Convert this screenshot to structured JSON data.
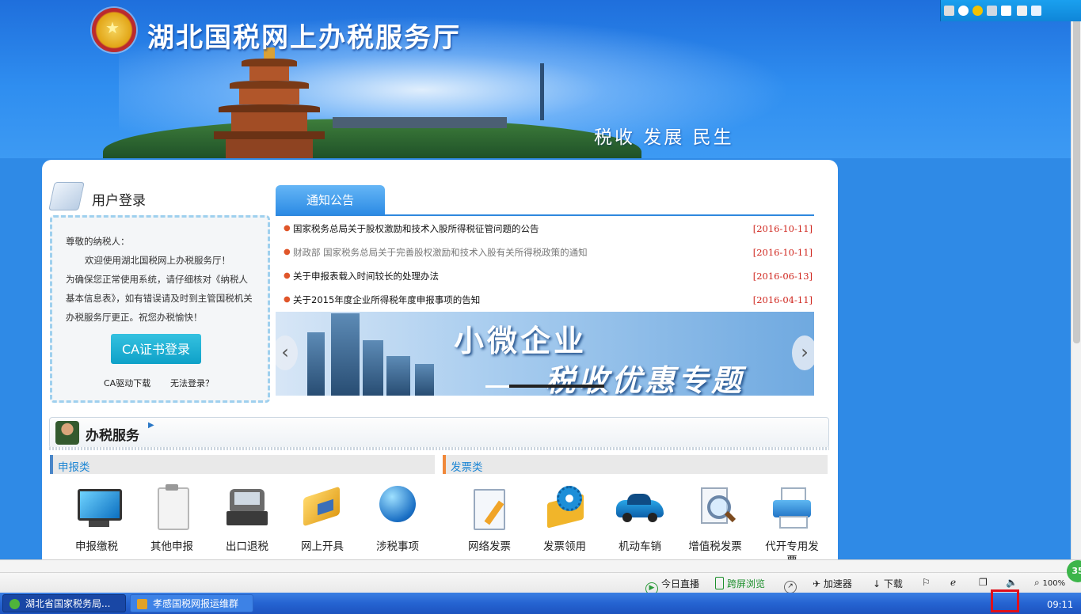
{
  "header": {
    "site_title": "湖北国税网上办税服务厅",
    "slogan": "税收  发展  民生"
  },
  "login": {
    "title": "用户登录",
    "greeting": "尊敬的纳税人：",
    "welcome": "欢迎使用湖北国税网上办税服务厅！",
    "notice_text": "为确保您正常使用系统，请仔细核对《纳税人基本信息表》，如有错误请及时到主管国税机关办税服务厅更正。祝您办税愉快！",
    "ca_button": "CA证书登录",
    "ca_driver_link": "CA驱动下载",
    "cannot_login_link": "无法登录？"
  },
  "notice": {
    "tab_label": "通知公告",
    "items": [
      {
        "text": "国家税务总局关于股权激励和技术入股所得税征管问题的公告",
        "date": "[2016-10-11]"
      },
      {
        "text": "财政部  国家税务总局关于完善股权激励和技术入股有关所得税政策的通知",
        "date": "[2016-10-11]"
      },
      {
        "text": "关于申报表载入时间较长的处理办法",
        "date": "[2016-06-13]"
      },
      {
        "text": "关于2015年度企业所得税年度申报事项的告知",
        "date": "[2016-04-11]"
      }
    ]
  },
  "banner": {
    "line1": "小微企业",
    "line2": "税收优惠专题",
    "prev": "‹",
    "next": "›"
  },
  "services": {
    "title": "办税服务",
    "category_declare": "申报类",
    "category_invoice": "发票类",
    "declare_items": [
      "申报缴税",
      "其他申报",
      "出口退税",
      "网上开具",
      "涉税事项"
    ],
    "invoice_items": [
      "网络发票",
      "发票领用",
      "机动车销",
      "增值税发票",
      "代开专用发票"
    ]
  },
  "browser_toolbar": {
    "live": "今日直播",
    "cross_screen": "跨屏浏览",
    "accelerator": "加速器",
    "download": "下载",
    "zoom": "100%",
    "badge": "35"
  },
  "taskbar": {
    "task1": "湖北省国家税务局...",
    "task2": "孝感国税网报运维群",
    "clock": "09:11"
  },
  "colors": {
    "accent": "#2f88de",
    "date_red": "#d0271f",
    "ca_button": "#17a9d0",
    "declare_bar": "#4a86c8",
    "invoice_bar": "#f0883a"
  }
}
